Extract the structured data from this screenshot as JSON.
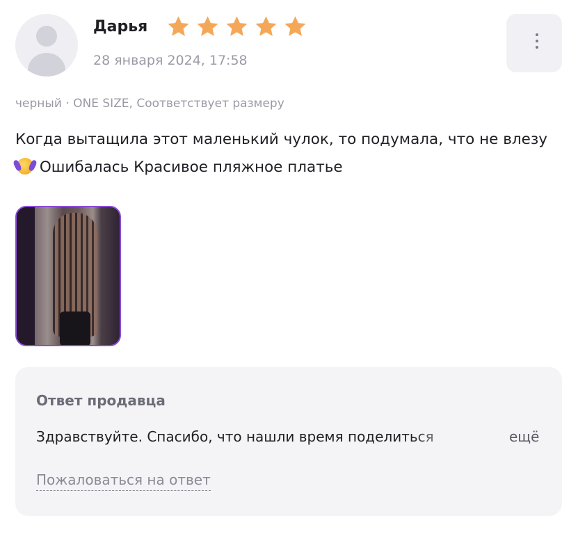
{
  "review": {
    "author": "Дарья",
    "rating": 5,
    "rating_max": 5,
    "date": "28 января 2024, 17:58",
    "params": "черный · ONE SIZE, Соответствует размеру",
    "text_before_emoji": "Когда вытащила этот маленький чулок, то подумала, что не влезу",
    "emoji_icon": "face-with-hand-over-mouth-icon",
    "text_after_emoji": " Ошибалась Красивое пляжное платье",
    "photos_count": 1
  },
  "seller_reply": {
    "title": "Ответ продавца",
    "text": "Здравствуйте. Спасибо, что нашли время поделиться",
    "more_label": "ещё",
    "complain_label": "Пожаловаться на ответ"
  },
  "colors": {
    "star": "#f5a758",
    "photo_border": "#8b4bd6",
    "reply_bg": "#f4f4f7"
  }
}
